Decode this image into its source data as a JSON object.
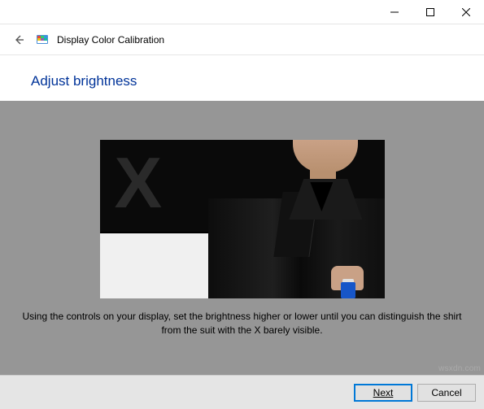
{
  "titlebar": {},
  "header": {
    "title": "Display Color Calibration"
  },
  "content": {
    "step_title": "Adjust brightness",
    "instruction": "Using the controls on your display, set the brightness higher or lower until you can distinguish the shirt from the suit with the X barely visible."
  },
  "buttons": {
    "next": "Next",
    "cancel": "Cancel"
  },
  "watermark": "wsxdn.com"
}
